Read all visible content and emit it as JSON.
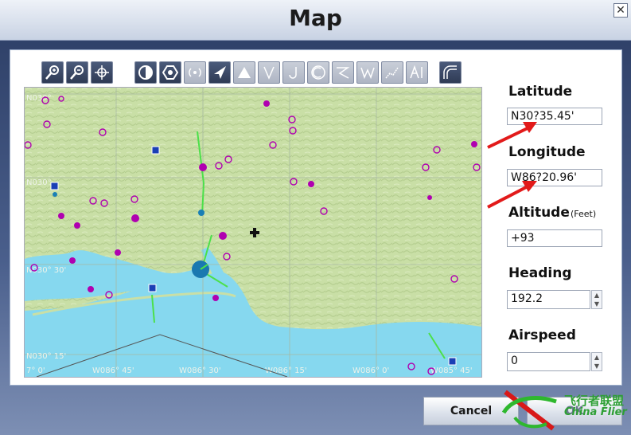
{
  "window": {
    "title": "Map",
    "close_label": "✕"
  },
  "toolbar": {
    "buttons": [
      {
        "icon": "zoom-in-icon",
        "state": "on"
      },
      {
        "icon": "zoom-out-icon",
        "state": "on"
      },
      {
        "icon": "center-icon",
        "state": "on"
      },
      {
        "icon": "vor-icon",
        "state": "on"
      },
      {
        "icon": "ndb-icon",
        "state": "on"
      },
      {
        "icon": "beacon-icon",
        "state": "off"
      },
      {
        "icon": "aircraft-icon",
        "state": "on"
      },
      {
        "icon": "triangle-icon",
        "state": "off"
      },
      {
        "icon": "airway-v-icon",
        "state": "off"
      },
      {
        "icon": "airway-j-icon",
        "state": "off"
      },
      {
        "icon": "restricted-icon",
        "state": "off"
      },
      {
        "icon": "route-icon",
        "state": "off"
      },
      {
        "icon": "waypoint-w-icon",
        "state": "off"
      },
      {
        "icon": "track-icon",
        "state": "off"
      },
      {
        "icon": "airport-label-icon",
        "state": "off"
      },
      {
        "icon": "terrain-icon",
        "state": "on"
      }
    ]
  },
  "map": {
    "grid_labels": {
      "top_left": "N030°",
      "left_mid": "N030°",
      "left_low": "N030° 30'",
      "left_bottom": "N030° 15'",
      "bottom_0": "7° 0'",
      "bottom_1": "W086° 45'",
      "bottom_2": "W086° 30'",
      "bottom_3": "W086° 15'",
      "bottom_4": "W086° 0'",
      "bottom_5": "W085° 45'"
    },
    "colors": {
      "land": "#c9dfa6",
      "water": "#86d8ef",
      "airport": "#b000b0",
      "vor": "#1a3fb5"
    }
  },
  "fields": {
    "latitude": {
      "label": "Latitude",
      "value": "N30?35.45'"
    },
    "longitude": {
      "label": "Longitude",
      "value": "W86?20.96'"
    },
    "altitude": {
      "label": "Altitude",
      "unit": "(Feet)",
      "value": "+93"
    },
    "heading": {
      "label": "Heading",
      "value": "192.2"
    },
    "airspeed": {
      "label": "Airspeed",
      "value": "0"
    }
  },
  "buttons": {
    "cancel": "Cancel",
    "ok": "OK"
  },
  "watermark": {
    "line1": "飞行者联盟",
    "line2": "China Flier"
  }
}
